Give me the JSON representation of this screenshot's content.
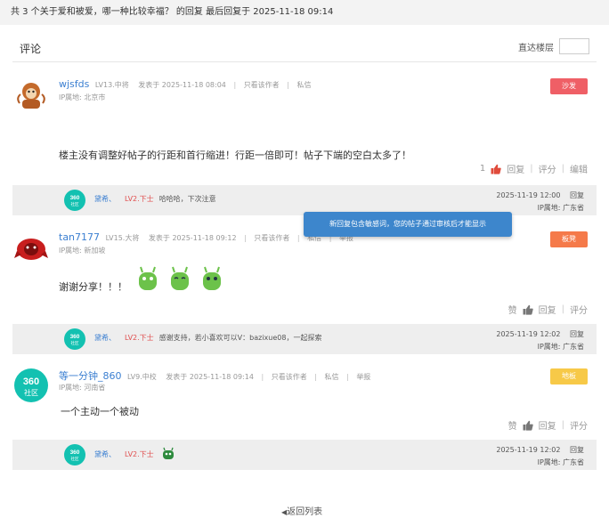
{
  "topbar": {
    "text": "共 3 个关于爱和被爱，哪一种比较幸福？ 的回复 最后回复于 2025-11-18 09:14"
  },
  "section": {
    "title": "评论",
    "jump_label": "直达楼层"
  },
  "posts": [
    {
      "username": "wjsfds",
      "level": "LV13.中将",
      "posted": "发表于 2025-11-18 08:04",
      "only_author": "只看该作者",
      "message": "私信",
      "ip": "IP属地: 北京市",
      "floor": "沙发",
      "floor_color": "#ef5f66",
      "content": "楼主没有调整好帖子的行距和首行缩进！行距一倍即可！帖子下端的空白太多了！",
      "likes": "1",
      "reply": "回复",
      "rate": "评分",
      "edit": "编辑",
      "sub_reply": {
        "user": "黛希、",
        "level": "LV2.下士",
        "text": "哈哈哈，下次注意",
        "time": "2025-11-19 12:00",
        "reply": "回复",
        "ip": "IP属地: 广东省"
      }
    },
    {
      "username": "tan7177",
      "level": "LV15.大将",
      "posted": "发表于 2025-11-18 09:12",
      "only_author": "只看该作者",
      "message": "私信",
      "report": "举报",
      "ip": "IP属地: 新加坡",
      "floor": "板凳",
      "floor_color": "#f57a4a",
      "content": "谢谢分享！！！",
      "like_label": "赞",
      "reply": "回复",
      "rate": "评分",
      "sub_reply": {
        "user": "黛希、",
        "level": "LV2.下士",
        "text": "感谢支持，若小喜欢可以V：bazixue08，一起探索",
        "time": "2025-11-19 12:02",
        "reply": "回复",
        "ip": "IP属地: 广东省"
      }
    },
    {
      "username": "等一分钟_860",
      "level": "LV9.中校",
      "posted": "发表于 2025-11-18 09:14",
      "only_author": "只看该作者",
      "message": "私信",
      "report": "举报",
      "ip": "IP属地: 河南省",
      "floor": "地板",
      "floor_color": "#f7c948",
      "content": "一个主动一个被动",
      "like_label": "赞",
      "reply": "回复",
      "rate": "评分",
      "sub_reply": {
        "user": "黛希、",
        "level": "LV2.下士",
        "text": "",
        "time": "2025-11-19 12:02",
        "reply": "回复",
        "ip": "IP属地: 广东省"
      }
    }
  ],
  "toast": {
    "text": "新回复包含敏感词，您的帖子通过审核后才能显示"
  },
  "back": {
    "label": "返回列表"
  },
  "logo_text": {
    "line1": "360",
    "line2": "社区"
  }
}
